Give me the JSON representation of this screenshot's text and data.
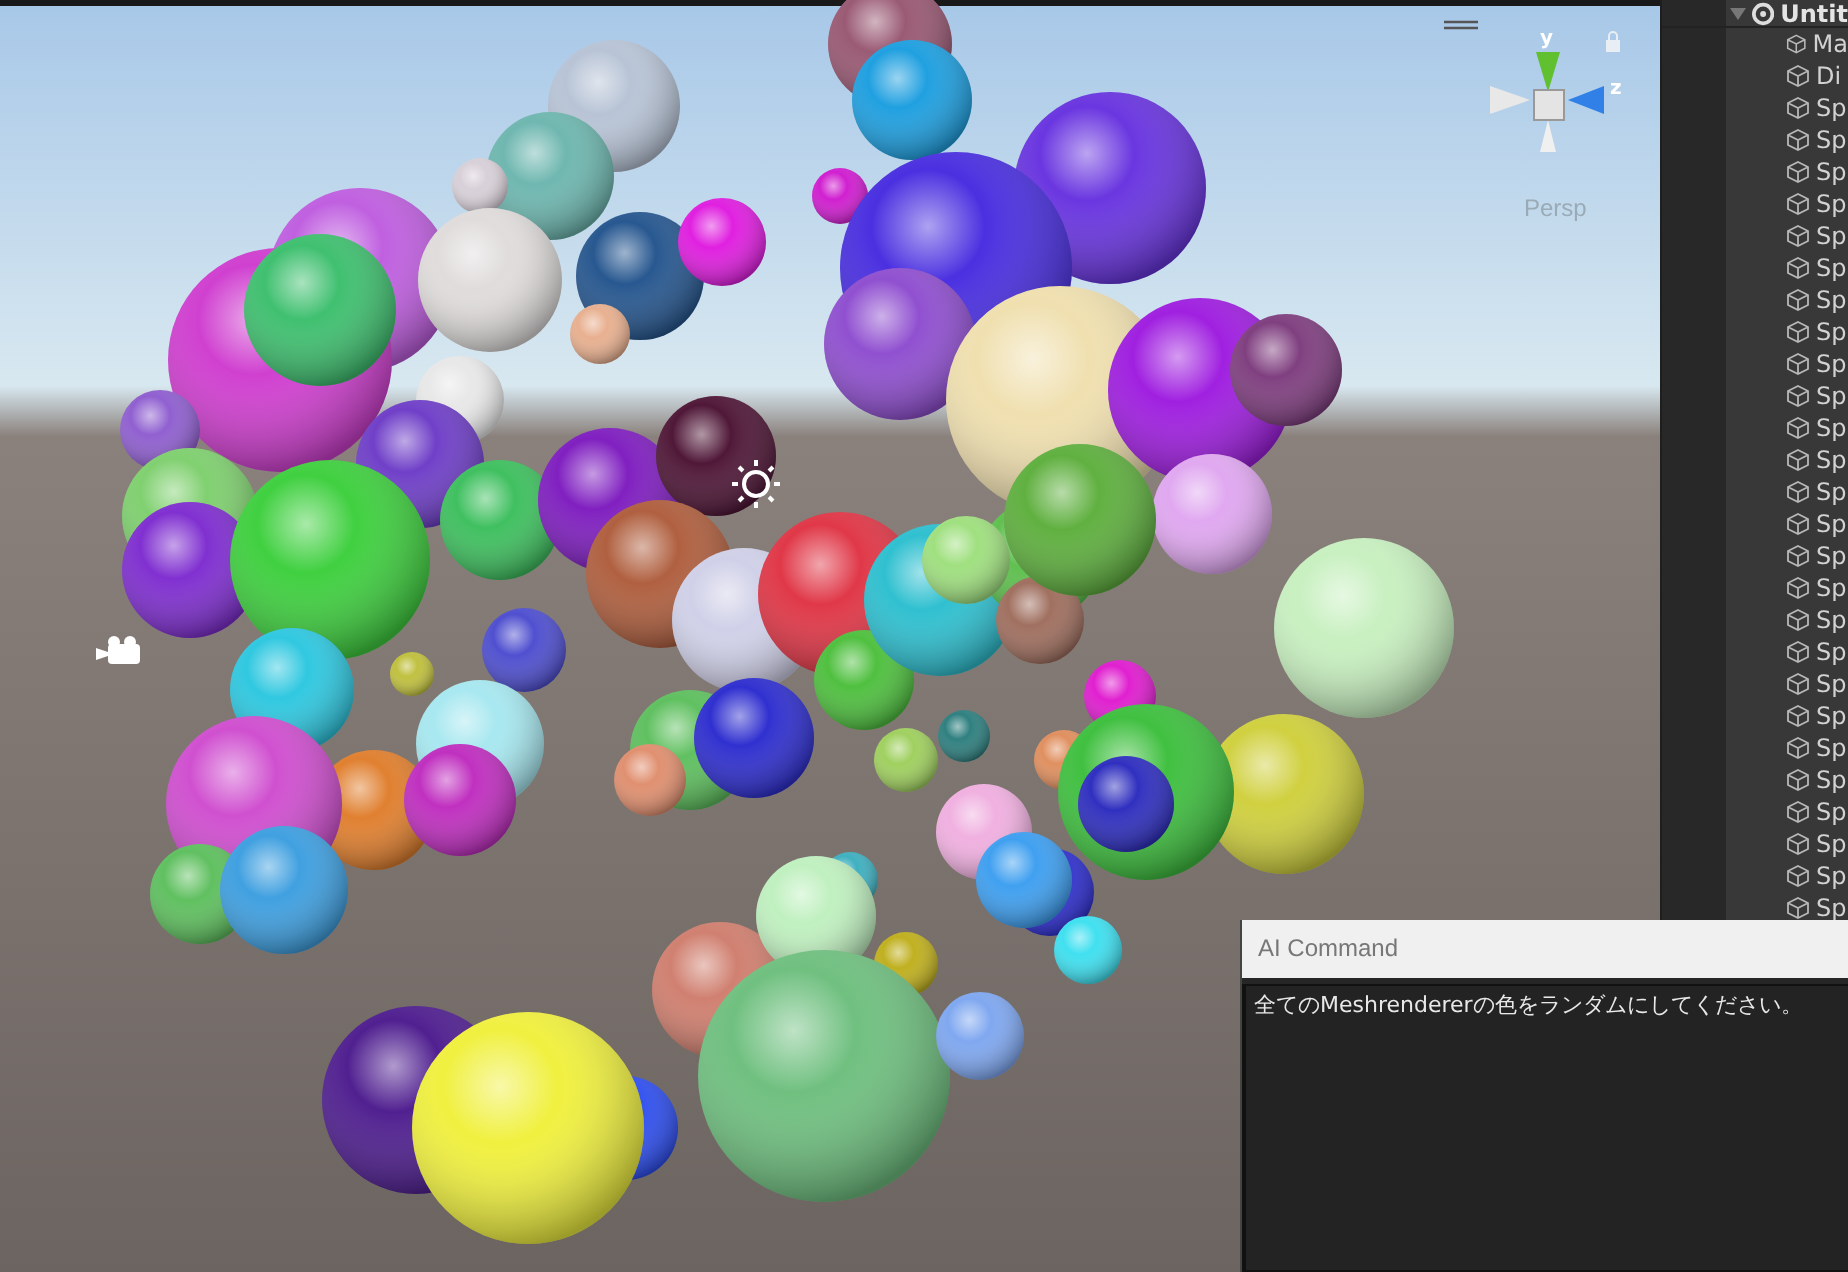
{
  "scene": {
    "gizmo": {
      "y_label": "y",
      "z_label": "z"
    },
    "projection": "Persp"
  },
  "hierarchy": {
    "root": {
      "label": "Untit",
      "expanded": true,
      "children": [
        {
          "label": "Ma"
        },
        {
          "label": "Di"
        },
        {
          "label": "Sp"
        },
        {
          "label": "Sp"
        },
        {
          "label": "Sp"
        },
        {
          "label": "Sp"
        },
        {
          "label": "Sp"
        },
        {
          "label": "Sp"
        },
        {
          "label": "Sp"
        },
        {
          "label": "Sp"
        },
        {
          "label": "Sp"
        },
        {
          "label": "Sp"
        },
        {
          "label": "Sp"
        },
        {
          "label": "Sp"
        },
        {
          "label": "Sp"
        },
        {
          "label": "Sp"
        },
        {
          "label": "Sp"
        },
        {
          "label": "Sp"
        },
        {
          "label": "Sp"
        },
        {
          "label": "Sp"
        },
        {
          "label": "Sp"
        },
        {
          "label": "Sp"
        },
        {
          "label": "Sp"
        },
        {
          "label": "Sp"
        },
        {
          "label": "Sp"
        },
        {
          "label": "Sp"
        },
        {
          "label": "Sp"
        },
        {
          "label": "Sp"
        }
      ]
    }
  },
  "ai_command": {
    "title": "AI Command",
    "value": "全てのMeshrendererの色をランダムにしてください。"
  }
}
